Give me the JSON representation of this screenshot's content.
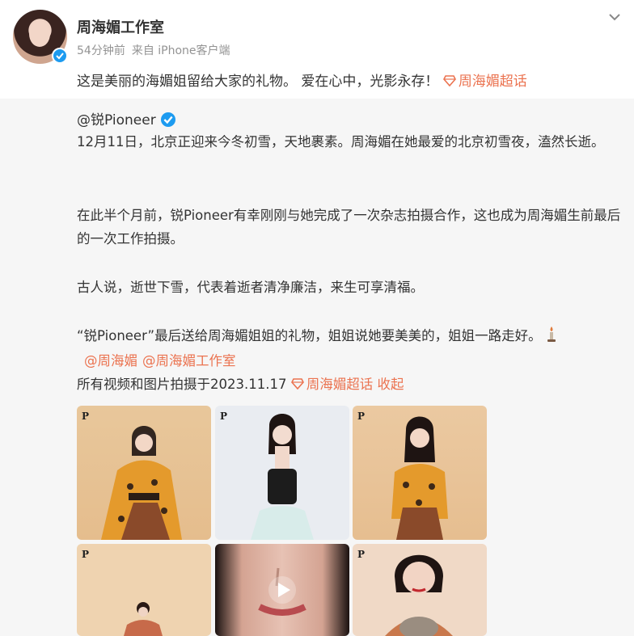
{
  "post": {
    "author": "周海媚工作室",
    "time": "54分钟前",
    "source": "来自 iPhone客户端",
    "text": "这是美丽的海媚姐留给大家的礼物。 爱在心中，光影永存！",
    "topic": "周海媚超话"
  },
  "repost": {
    "author": "@锐Pioneer",
    "paragraphs": [
      "12月11日，北京正迎来今冬初雪，天地裹素。周海媚在她最爱的北京初雪夜，溘然长逝。",
      "在此半个月前，锐Pioneer有幸刚刚与她完成了一次杂志拍摄合作，这也成为周海媚生前最后的一次工作拍摄。",
      "古人说，逝世下雪，代表着逝者清净廉洁，来生可享清福。",
      "“锐Pioneer”最后送给周海媚姐姐的礼物，姐姐说她要美美的，姐姐一路走好。"
    ],
    "mentions": [
      "@周海媚",
      "@周海媚工作室"
    ],
    "shot_date": "所有视频和图片拍摄于2023.11.17",
    "topic": "周海媚超话",
    "collapse": "收起",
    "photo_logo": "P"
  },
  "icons": [
    "verified-icon",
    "chevron-down-icon",
    "topic-icon",
    "candle-icon",
    "play-icon"
  ],
  "colors": {
    "accent": "#eb7350",
    "verified": "#1d9bf0",
    "repost_bg": "#f6f6f6"
  }
}
